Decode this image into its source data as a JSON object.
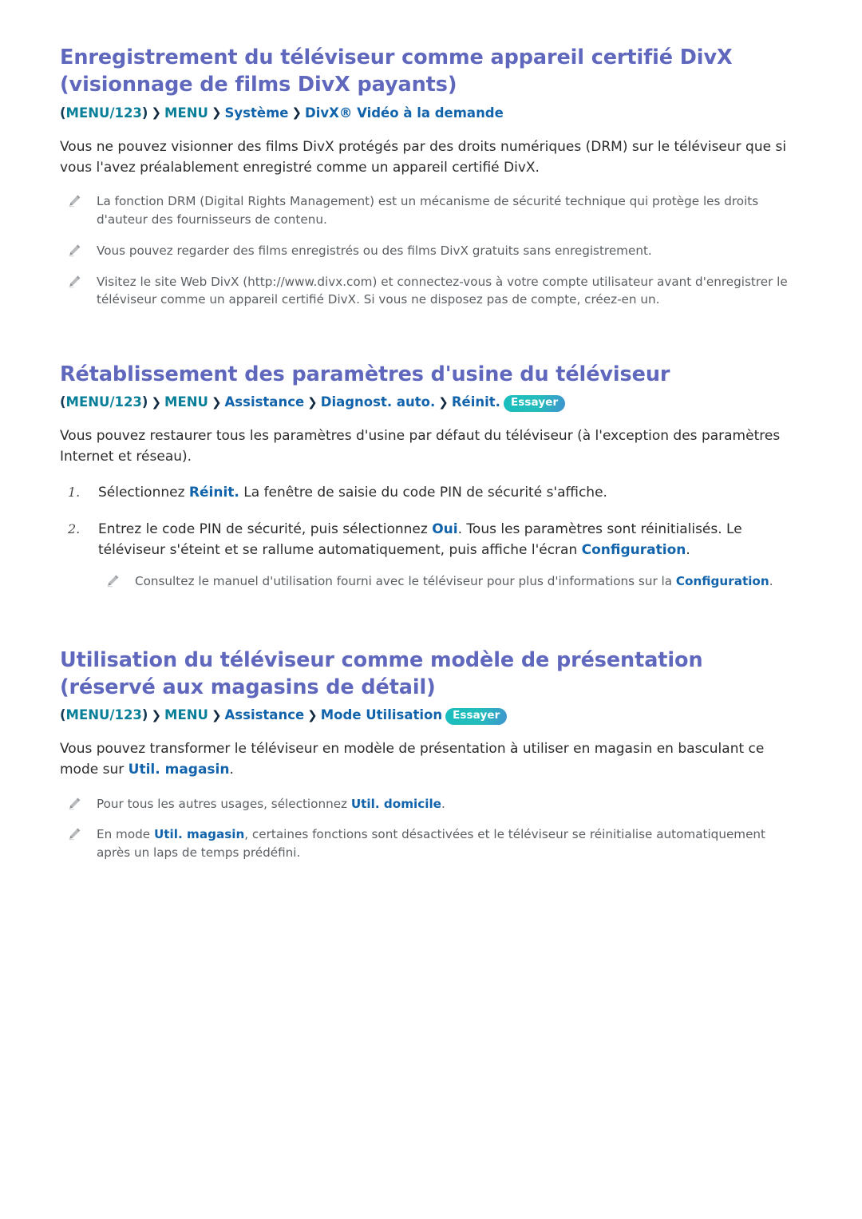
{
  "page": {
    "language": "fr",
    "background": "#ffffff",
    "heading_color": "#6068bd",
    "accent_teal": "#0a7f99",
    "accent_blue": "#1163ab",
    "body_color": "#2b2b2b",
    "note_color": "#5a5f63",
    "pill_color": "#24bdbb"
  },
  "sections": [
    {
      "id": "divx-registration",
      "title": "Enregistrement du téléviseur comme appareil certifié DivX (visionnage de films DivX payants)",
      "breadcrumb": {
        "open_paren": "(",
        "menu123": "MENU/123",
        "close_paren": ")",
        "sep": "❯",
        "items": [
          "MENU",
          "Système",
          "DivX® Vidéo à la demande"
        ],
        "pill": ""
      },
      "body": "Vous ne pouvez visionner des films DivX protégés par des droits numériques (DRM) sur le téléviseur que si vous l'avez préalablement enregistré comme un appareil certifié DivX.",
      "notes": [
        "La fonction DRM (Digital Rights Management) est un mécanisme de sécurité technique qui protège les droits d'auteur des fournisseurs de contenu.",
        "Vous pouvez regarder des films enregistrés ou des films DivX gratuits sans enregistrement.",
        "Visitez le site Web DivX (http://www.divx.com) et connectez-vous à votre compte utilisateur avant d'enregistrer le téléviseur comme un appareil certifié DivX. Si vous ne disposez pas de compte, créez-en un."
      ]
    },
    {
      "id": "factory-reset",
      "title": "Rétablissement des paramètres d'usine du téléviseur",
      "breadcrumb": {
        "open_paren": "(",
        "menu123": "MENU/123",
        "close_paren": ")",
        "sep": "❯",
        "items": [
          "MENU",
          "Assistance",
          "Diagnost. auto.",
          "Réinit."
        ],
        "pill": "Essayer"
      },
      "body": "Vous pouvez restaurer tous les paramètres d'usine par défaut du téléviseur (à l'exception des paramètres Internet et réseau).",
      "steps": [
        {
          "marker": "1.",
          "text_before": "Sélectionnez ",
          "bold": "Réinit.",
          "text_after": " La fenêtre de saisie du code PIN de sécurité s'affiche."
        },
        {
          "marker": "2.",
          "text_before": "Entrez le code PIN de sécurité, puis sélectionnez ",
          "bold": "Oui",
          "text_mid": ". Tous les paramètres sont réinitialisés. Le téléviseur s'éteint et se rallume automatiquement, puis affiche l'écran ",
          "bold2": "Configuration",
          "text_after": ".",
          "note_before": "Consultez le manuel d'utilisation fourni avec le téléviseur pour plus d'informations sur la ",
          "note_bold": "Configuration",
          "note_after": "."
        }
      ]
    },
    {
      "id": "retail-demo-mode",
      "title": "Utilisation du téléviseur comme modèle de présentation (réservé aux magasins de détail)",
      "breadcrumb": {
        "open_paren": "(",
        "menu123": "MENU/123",
        "close_paren": ")",
        "sep": "❯",
        "items": [
          "MENU",
          "Assistance",
          "Mode Utilisation"
        ],
        "pill": "Essayer"
      },
      "body_before": "Vous pouvez transformer le téléviseur en modèle de présentation à utiliser en magasin en basculant ce mode sur ",
      "body_bold": "Util. magasin",
      "body_after": ".",
      "notes": [
        {
          "before": "Pour tous les autres usages, sélectionnez ",
          "bold": "Util. domicile",
          "after": "."
        },
        {
          "before": "En mode ",
          "bold": "Util. magasin",
          "after": ", certaines fonctions sont désactivées et le téléviseur se réinitialise automatiquement après un laps de temps prédéfini."
        }
      ]
    }
  ],
  "icons": {
    "pencil": "pencil-icon",
    "chevron": "chevron-right-icon"
  }
}
